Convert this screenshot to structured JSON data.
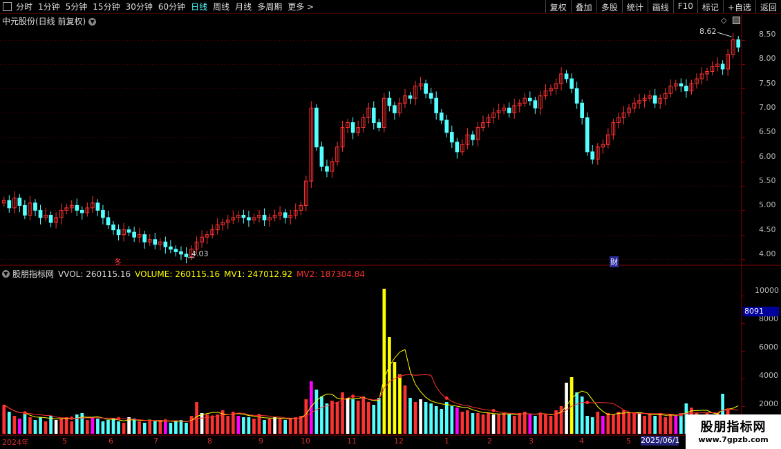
{
  "toolbar": {
    "periods": [
      "分时",
      "1分钟",
      "5分钟",
      "15分钟",
      "30分钟",
      "60分钟",
      "日线",
      "周线",
      "月线",
      "多周期",
      "更多 >"
    ],
    "active_period": "日线",
    "actions": [
      "复权",
      "叠加",
      "多股",
      "统计",
      "画线",
      "F10",
      "标记",
      "+自选",
      "返回"
    ]
  },
  "stock": {
    "title": "中元股份(日线 前复权)",
    "high_label": "8.62",
    "low_label": "4.03",
    "event_mark_1": "冬",
    "event_mark_2": "财"
  },
  "price_axis": [
    "8.50",
    "8.00",
    "7.50",
    "7.00",
    "6.50",
    "6.00",
    "5.50",
    "5.00",
    "4.50",
    "4.00"
  ],
  "indicator": {
    "name": "股朋指标网",
    "vvol": "VVOL: 260115.16",
    "volume": "VOLUME: 260115.16",
    "mv1": "MV1: 247012.92",
    "mv2": "MV2: 187304.84",
    "colors": {
      "name": "#dddddd",
      "vvol": "#dddddd",
      "volume": "#ffff00",
      "mv1": "#ffff00",
      "mv2": "#ff3030"
    }
  },
  "volume_axis": [
    "10000",
    "8000",
    "6000",
    "4000",
    "2000"
  ],
  "volume_badge": "8091",
  "date_axis": [
    "2024年",
    "5",
    "6",
    "7",
    "8",
    "9",
    "10",
    "11",
    "12",
    "1",
    "2",
    "3",
    "4",
    "5"
  ],
  "date_highlight": "2025/06/1",
  "watermark": {
    "title": "股朋指标网",
    "url": "www.7gpzb.com"
  },
  "colors": {
    "up": "#ff3232",
    "down": "#54ffff",
    "grid": "#6a0000",
    "border": "#8a0000"
  },
  "chart_data": {
    "type": "candlestick",
    "title": "中元股份(日线 前复权)",
    "annotations": [
      "8.62",
      "4.03"
    ],
    "close": [
      5.2,
      5.05,
      5.25,
      5.1,
      4.9,
      5.15,
      5.0,
      4.85,
      4.9,
      4.75,
      4.85,
      5.0,
      5.05,
      5.1,
      5.0,
      4.95,
      5.05,
      5.15,
      5.0,
      4.85,
      4.7,
      4.6,
      4.5,
      4.6,
      4.55,
      4.45,
      4.5,
      4.35,
      4.4,
      4.3,
      4.35,
      4.25,
      4.2,
      4.15,
      4.1,
      4.05,
      4.2,
      4.35,
      4.45,
      4.5,
      4.6,
      4.7,
      4.75,
      4.8,
      4.85,
      4.9,
      4.85,
      4.8,
      4.85,
      4.9,
      4.8,
      4.85,
      4.9,
      4.95,
      4.85,
      4.9,
      5.0,
      5.1,
      5.6,
      7.1,
      6.3,
      5.9,
      5.8,
      6.0,
      6.3,
      6.7,
      6.8,
      6.6,
      6.7,
      6.9,
      7.1,
      6.8,
      6.7,
      7.3,
      7.15,
      7.0,
      7.2,
      7.35,
      7.3,
      7.55,
      7.6,
      7.4,
      7.3,
      7.0,
      6.85,
      6.6,
      6.4,
      6.2,
      6.35,
      6.55,
      6.45,
      6.7,
      6.8,
      6.9,
      7.0,
      7.05,
      7.1,
      7.0,
      7.15,
      7.2,
      7.3,
      7.25,
      7.1,
      7.35,
      7.45,
      7.5,
      7.6,
      7.8,
      7.7,
      7.5,
      7.2,
      6.9,
      6.2,
      6.05,
      6.3,
      6.35,
      6.55,
      6.8,
      6.9,
      7.0,
      7.1,
      7.2,
      7.25,
      7.3,
      7.35,
      7.2,
      7.3,
      7.4,
      7.55,
      7.6,
      7.55,
      7.45,
      7.6,
      7.7,
      7.8,
      7.85,
      7.95,
      8.0,
      7.9,
      8.2,
      8.5,
      8.35
    ],
    "volume": [
      2100,
      1600,
      1300,
      1100,
      1500,
      1200,
      1000,
      1200,
      900,
      1300,
      1000,
      1100,
      1200,
      900,
      1400,
      1500,
      1000,
      1200,
      1100,
      900,
      1000,
      1100,
      900,
      800,
      1200,
      1100,
      900,
      800,
      1000,
      900,
      1000,
      900,
      800,
      900,
      1000,
      800,
      1300,
      2300,
      1500,
      1400,
      1200,
      1400,
      1700,
      1300,
      1600,
      1300,
      1200,
      1200,
      1100,
      1300,
      1000,
      1100,
      1200,
      1100,
      1000,
      1100,
      1200,
      1300,
      2500,
      3800,
      3200,
      2700,
      2200,
      2400,
      2300,
      3000,
      2600,
      2500,
      2400,
      2700,
      2300,
      2100,
      2600,
      10500,
      7000,
      5200,
      4300,
      3500,
      2600,
      2300,
      2500,
      2300,
      2200,
      2000,
      1800,
      2300,
      2000,
      1900,
      1600,
      1700,
      1500,
      1500,
      1400,
      1500,
      1400,
      1400,
      1500,
      1400,
      1300,
      1500,
      1600,
      1400,
      1300,
      1500,
      1400,
      1300,
      1700,
      2000,
      3700,
      4100,
      3000,
      2700,
      1300,
      1200,
      1600,
      1300,
      1500,
      1400,
      1600,
      1700,
      1500,
      1400,
      1500,
      1300,
      1400,
      1300,
      1500,
      1200,
      1400,
      1300,
      1500,
      2200,
      1900,
      1500,
      1400,
      1500,
      1300,
      1500,
      2900,
      1700
    ],
    "ylim": [
      3.9,
      8.75
    ],
    "volume_ylim": [
      0,
      11500
    ]
  }
}
